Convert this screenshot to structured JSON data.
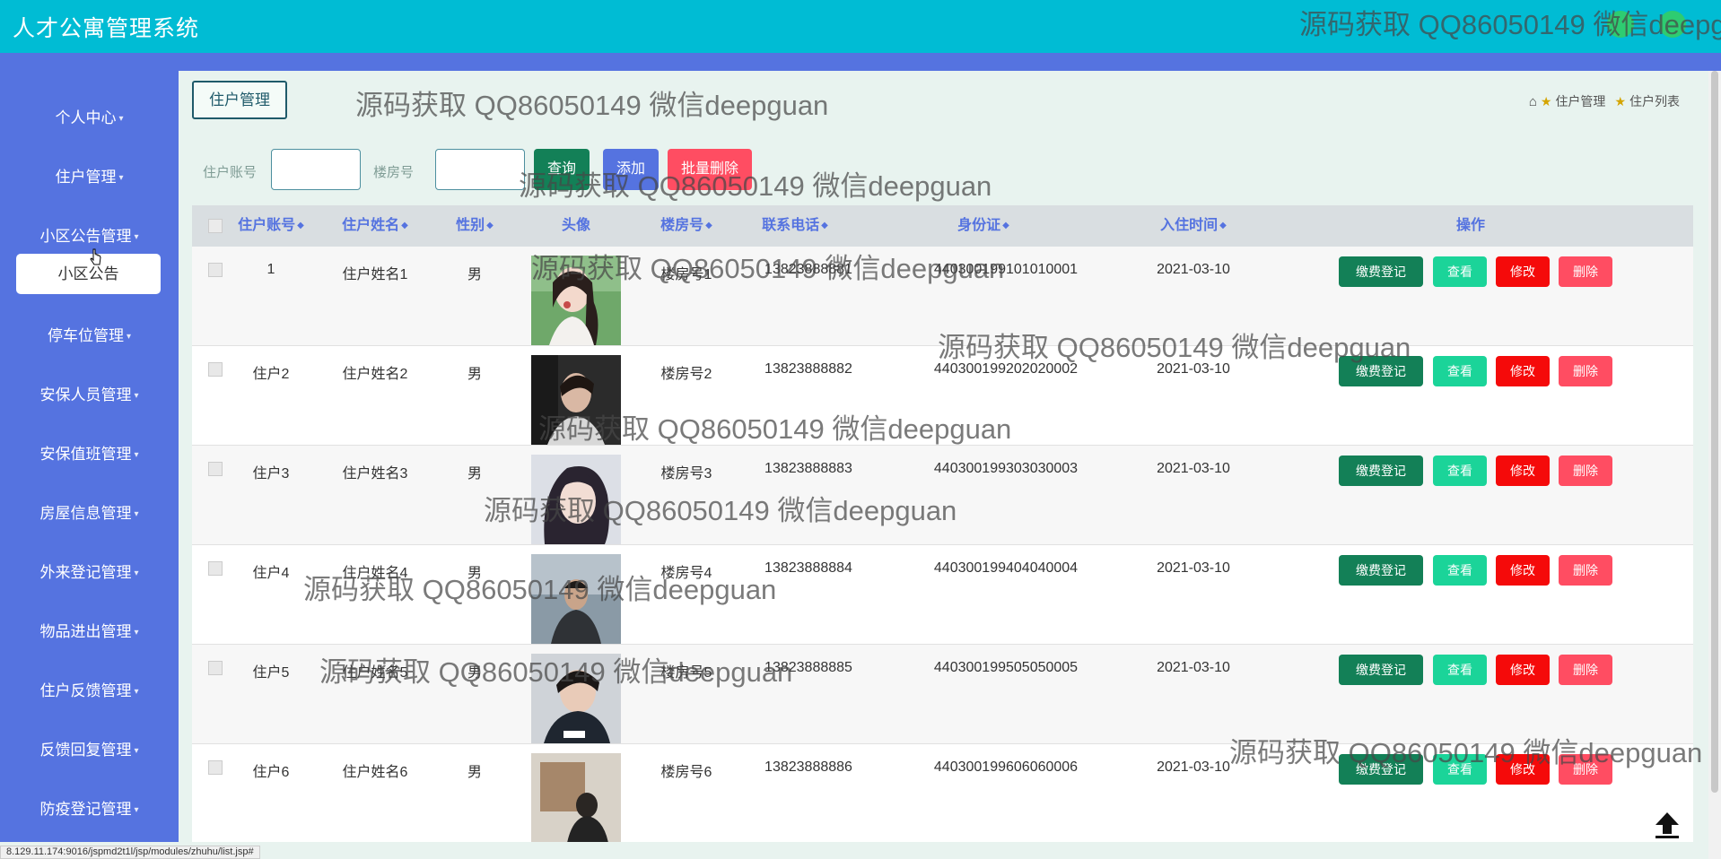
{
  "app": {
    "title": "人才公寓管理系统"
  },
  "sidebar": {
    "items": [
      {
        "label": "个人中心"
      },
      {
        "label": "住户管理"
      },
      {
        "label": "小区公告管理"
      },
      {
        "label": "停车位管理"
      },
      {
        "label": "安保人员管理"
      },
      {
        "label": "安保值班管理"
      },
      {
        "label": "房屋信息管理"
      },
      {
        "label": "外来登记管理"
      },
      {
        "label": "物品进出管理"
      },
      {
        "label": "住户反馈管理"
      },
      {
        "label": "反馈回复管理"
      },
      {
        "label": "防疫登记管理"
      }
    ],
    "open_submenu": {
      "label": "小区公告"
    }
  },
  "page": {
    "tab_label": "住户管理",
    "breadcrumb": [
      "住户管理",
      "住户列表"
    ]
  },
  "search": {
    "account_label": "住户账号",
    "building_label": "楼房号",
    "account_value": "",
    "building_value": "",
    "query_button": "查询",
    "add_button": "添加",
    "batch_delete_button": "批量删除"
  },
  "table": {
    "columns": [
      "住户账号",
      "住户姓名",
      "性别",
      "头像",
      "楼房号",
      "联系电话",
      "身份证",
      "入住时间",
      "操作"
    ],
    "rows": [
      {
        "account": "1",
        "name": "住户姓名1",
        "gender": "男",
        "building": "楼房号1",
        "phone": "13823888881",
        "id_card": "440300199101010001",
        "move_in": "2021-03-10"
      },
      {
        "account": "住户2",
        "name": "住户姓名2",
        "gender": "男",
        "building": "楼房号2",
        "phone": "13823888882",
        "id_card": "440300199202020002",
        "move_in": "2021-03-10"
      },
      {
        "account": "住户3",
        "name": "住户姓名3",
        "gender": "男",
        "building": "楼房号3",
        "phone": "13823888883",
        "id_card": "440300199303030003",
        "move_in": "2021-03-10"
      },
      {
        "account": "住户4",
        "name": "住户姓名4",
        "gender": "男",
        "building": "楼房号4",
        "phone": "13823888884",
        "id_card": "440300199404040004",
        "move_in": "2021-03-10"
      },
      {
        "account": "住户5",
        "name": "住户姓名5",
        "gender": "男",
        "building": "楼房号5",
        "phone": "13823888885",
        "id_card": "440300199505050005",
        "move_in": "2021-03-10"
      },
      {
        "account": "住户6",
        "name": "住户姓名6",
        "gender": "男",
        "building": "楼房号6",
        "phone": "13823888886",
        "id_card": "440300199606060006",
        "move_in": "2021-03-10"
      }
    ],
    "actions": {
      "pay": "缴费登记",
      "view": "查看",
      "edit": "修改",
      "delete": "删除"
    }
  },
  "watermark": {
    "text": "源码获取 QQ86050149 微信deepguan",
    "text_cut": "源码获取 QQ86050149 微信deepg"
  },
  "status_url": "8.129.11.174:9016/jspmd2t1l/jsp/modules/zhuhu/list.jsp#",
  "colors": {
    "topbar": "#00bcd4",
    "sidebar": "#5573e0",
    "pay_button": "#138057",
    "view_button": "#1bd499",
    "edit_button": "#f50a0a",
    "delete_button": "#ff4d62",
    "query_button": "#138057",
    "add_button": "#5573e0",
    "batch_delete_button": "#ff4d62",
    "header_text": "#5573e0"
  }
}
